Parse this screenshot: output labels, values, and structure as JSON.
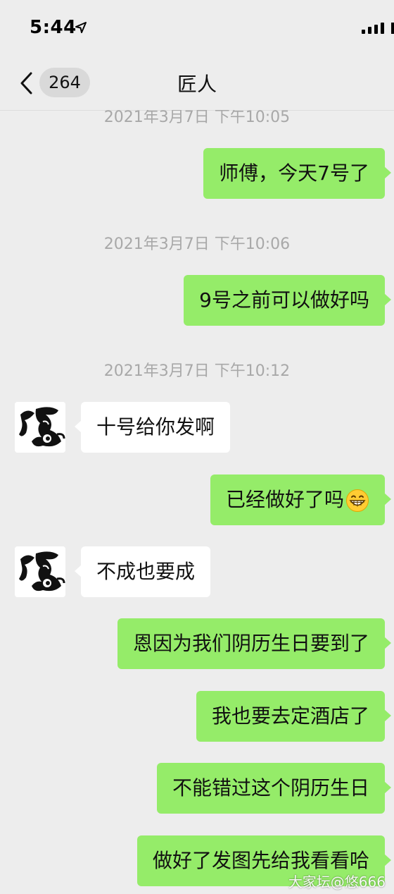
{
  "status_bar": {
    "time": "5:44"
  },
  "nav": {
    "unread_count": "264",
    "title": "匠人"
  },
  "messages": [
    {
      "type": "timestamp",
      "text": "2021年3月7日 下午10:05"
    },
    {
      "type": "out",
      "text": "师傅，今天7号了"
    },
    {
      "type": "timestamp",
      "text": "2021年3月7日 下午10:06"
    },
    {
      "type": "out",
      "text": "9号之前可以做好吗"
    },
    {
      "type": "timestamp",
      "text": "2021年3月7日 下午10:12"
    },
    {
      "type": "in",
      "text": "十号给你发啊"
    },
    {
      "type": "out",
      "text": "已经做好了吗",
      "emoji": "grinning-face-emoji"
    },
    {
      "type": "in",
      "text": "不成也要成"
    },
    {
      "type": "out",
      "text": "恩因为我们阴历生日要到了"
    },
    {
      "type": "out",
      "text": "我也要去定酒店了"
    },
    {
      "type": "out",
      "text": "不能错过这个阴历生日"
    },
    {
      "type": "out",
      "text": "做好了发图先给我看看哈"
    }
  ],
  "watermark": "大家坛@悠666",
  "colors": {
    "outgoing_bubble": "#95ec69",
    "incoming_bubble": "#ffffff",
    "background": "#ededed",
    "timestamp": "#a8a8a8"
  }
}
